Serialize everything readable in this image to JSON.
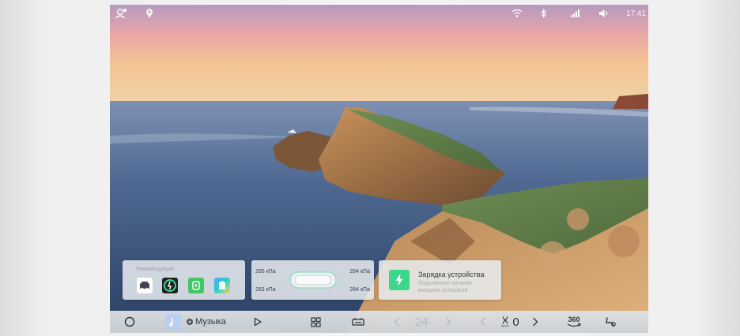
{
  "status_bar": {
    "time": "17:41",
    "icons": [
      "profile-icon",
      "location-pin-icon",
      "wifi-icon",
      "bluetooth-icon",
      "cellular-signal-icon",
      "volume-icon"
    ]
  },
  "widgets": {
    "recommendations": {
      "title": "Рекомендации",
      "apps": [
        "car-app-icon",
        "speed-app-icon",
        "green-app-icon",
        "gallery-app-icon"
      ]
    },
    "tire_pressure": {
      "front_left": "285 кПа",
      "front_right": "284 кПа",
      "rear_left": "283 кПа",
      "rear_right": "284 кПа"
    },
    "charging": {
      "title": "Зарядка устройства",
      "subtitle": "Подключите питание внешних устройств"
    }
  },
  "dock": {
    "home_icon": "home-circle-icon",
    "music_label": "Музыка",
    "play_icon": "play-icon",
    "apps_icon": "app-grid-icon",
    "car_icon": "car-outline-icon",
    "temperature": "24",
    "temperature_unit": "°",
    "fan_speed": "0",
    "camera_label": "360",
    "settings_icon": "seat-settings-icon"
  },
  "colors": {
    "charge_accent": "#3dd68a",
    "dock_bg": "#d9dde1"
  }
}
